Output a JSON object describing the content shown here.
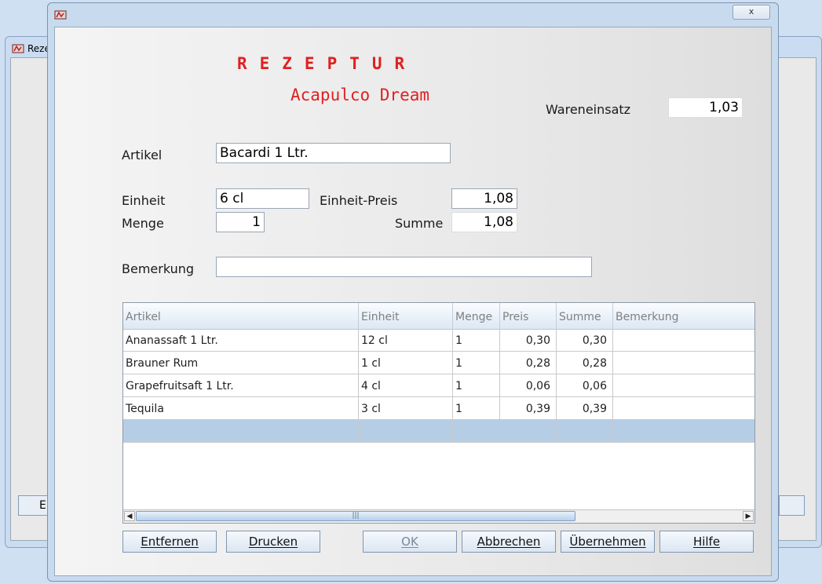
{
  "background_window": {
    "title": "Reze",
    "button_label": "E"
  },
  "dialog": {
    "close_label": "x",
    "heading": "REZEPTUR",
    "recipe_name": "Acapulco Dream",
    "wareneinsatz": {
      "label": "Wareneinsatz",
      "value": "1,03"
    },
    "artikel": {
      "label": "Artikel",
      "value": "Bacardi  1 Ltr."
    },
    "einheit": {
      "label": "Einheit",
      "value": "6 cl"
    },
    "einheit_preis": {
      "label": "Einheit-Preis",
      "value": "1,08"
    },
    "menge": {
      "label": "Menge",
      "value": "1"
    },
    "summe": {
      "label": "Summe",
      "value": "1,08"
    },
    "bemerkung": {
      "label": "Bemerkung",
      "value": ""
    }
  },
  "table": {
    "columns": [
      "Artikel",
      "Einheit",
      "Menge",
      "Preis",
      "Summe",
      "Bemerkung"
    ],
    "rows": [
      [
        "Ananassaft 1 Ltr.",
        "12 cl",
        "1",
        "0,30",
        "0,30",
        ""
      ],
      [
        "Brauner Rum",
        "1 cl",
        "1",
        "0,28",
        "0,28",
        ""
      ],
      [
        "Grapefruitsaft 1 Ltr.",
        "4 cl",
        "1",
        "0,06",
        "0,06",
        ""
      ],
      [
        "Tequila",
        "3 cl",
        "1",
        "0,39",
        "0,39",
        ""
      ]
    ]
  },
  "buttons": {
    "entfernen": "Entfernen",
    "drucken": "Drucken",
    "ok": "OK",
    "abbrechen": "Abbrechen",
    "uebernehmen": "Übernehmen",
    "hilfe": "Hilfe"
  },
  "colors": {
    "heading": "#e02020",
    "selection": "#b6cde6"
  }
}
